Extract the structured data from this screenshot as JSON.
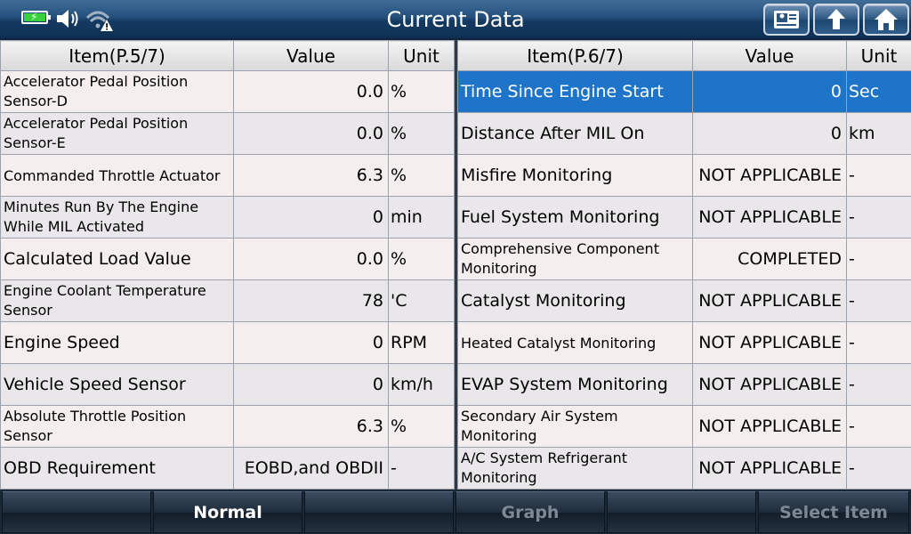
{
  "window": {
    "title": "Current Data"
  },
  "status": {
    "battery_icon": "battery-charging-icon",
    "volume_icon": "volume-icon",
    "wifi_icon": "wifi-warning-icon"
  },
  "toolbar": {
    "report_icon": "report-icon",
    "back_icon": "up-arrow-icon",
    "home_icon": "home-icon"
  },
  "left_table": {
    "headers": {
      "item": "Item(P.5/7)",
      "value": "Value",
      "unit": "Unit"
    },
    "rows": [
      {
        "item": "Accelerator Pedal Position Sensor-D",
        "value": "0.0",
        "unit": "%"
      },
      {
        "item": "Accelerator Pedal Position Sensor-E",
        "value": "0.0",
        "unit": "%"
      },
      {
        "item": "Commanded Throttle Actuator",
        "value": "6.3",
        "unit": "%"
      },
      {
        "item": "Minutes Run By The Engine While MIL Activated",
        "value": "0",
        "unit": "min"
      },
      {
        "item": "Calculated Load Value",
        "value": "0.0",
        "unit": "%"
      },
      {
        "item": "Engine Coolant Temperature Sensor",
        "value": "78",
        "unit": "'C"
      },
      {
        "item": "Engine Speed",
        "value": "0",
        "unit": "RPM"
      },
      {
        "item": "Vehicle Speed Sensor",
        "value": "0",
        "unit": "km/h"
      },
      {
        "item": "Absolute Throttle Position Sensor",
        "value": "6.3",
        "unit": "%"
      },
      {
        "item": "OBD Requirement",
        "value": "EOBD,and OBDII",
        "unit": "-"
      }
    ]
  },
  "right_table": {
    "headers": {
      "item": "Item(P.6/7)",
      "value": "Value",
      "unit": "Unit"
    },
    "rows": [
      {
        "item": "Time Since Engine Start",
        "value": "0",
        "unit": "Sec"
      },
      {
        "item": "Distance After MIL On",
        "value": "0",
        "unit": "km"
      },
      {
        "item": "Misfire Monitoring",
        "value": "NOT APPLICABLE",
        "unit": "-"
      },
      {
        "item": "Fuel System Monitoring",
        "value": "NOT APPLICABLE",
        "unit": "-"
      },
      {
        "item": "Comprehensive Component Monitoring",
        "value": "COMPLETED",
        "unit": "-"
      },
      {
        "item": "Catalyst Monitoring",
        "value": "NOT APPLICABLE",
        "unit": "-"
      },
      {
        "item": "Heated Catalyst Monitoring",
        "value": "NOT APPLICABLE",
        "unit": "-"
      },
      {
        "item": "EVAP System Monitoring",
        "value": "NOT APPLICABLE",
        "unit": "-"
      },
      {
        "item": "Secondary Air System Monitoring",
        "value": "NOT APPLICABLE",
        "unit": "-"
      },
      {
        "item": "A/C System Refrigerant Monitoring",
        "value": "NOT APPLICABLE",
        "unit": "-"
      }
    ]
  },
  "bottom_bar": {
    "buttons": [
      "",
      "Normal",
      "",
      "Graph",
      "",
      "Select Item"
    ]
  },
  "colors": {
    "selected_row": "#1d74c9",
    "title_bar": "#24507c"
  }
}
